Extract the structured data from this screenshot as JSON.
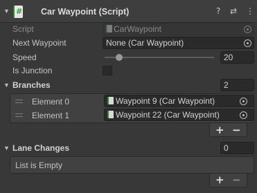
{
  "component": {
    "title": "Car Waypoint (Script)",
    "script_glyph": "#",
    "help_glyph": "?",
    "presets_glyph": "⇄",
    "menu_glyph": "⋮"
  },
  "fields": {
    "script_label": "Script",
    "script_value": "CarWaypoint",
    "next_waypoint_label": "Next Waypoint",
    "next_waypoint_value": "None (Car Waypoint)",
    "speed_label": "Speed",
    "speed_value": "20",
    "speed_fraction": 0.13,
    "is_junction_label": "Is Junction",
    "is_junction_checked": false
  },
  "branches": {
    "label": "Branches",
    "size": "2",
    "elements": [
      {
        "label": "Element 0",
        "value": "Waypoint 9 (Car Waypoint)"
      },
      {
        "label": "Element 1",
        "value": "Waypoint 22 (Car Waypoint)"
      }
    ],
    "add_glyph": "+",
    "remove_glyph": "−"
  },
  "lane_changes": {
    "label": "Lane Changes",
    "size": "0",
    "empty_text": "List is Empty",
    "add_glyph": "+",
    "remove_glyph": "−"
  },
  "icons": [
    "fold-arrow-icon",
    "script-icon",
    "help-icon",
    "presets-icon",
    "menu-icon",
    "object-picker-icon",
    "drag-handle-icon",
    "component-ref-icon"
  ]
}
